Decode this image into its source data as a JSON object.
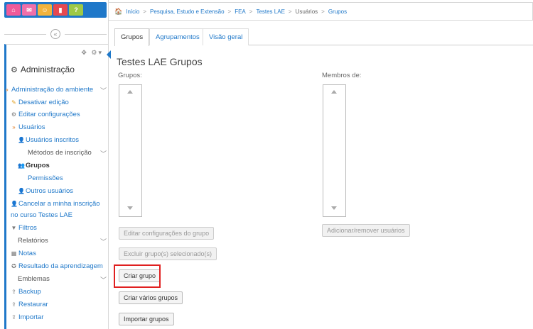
{
  "topbar": {
    "buttons": [
      {
        "icon": "home-icon",
        "glyph": "⌂"
      },
      {
        "icon": "mail-icon",
        "glyph": "✉"
      },
      {
        "icon": "users-icon",
        "glyph": "☺"
      },
      {
        "icon": "bookmark-icon",
        "glyph": "▮"
      },
      {
        "icon": "help-icon",
        "glyph": "?"
      }
    ],
    "colors": [
      "#f05a9a",
      "#ef6fa9",
      "#f2b33d",
      "#e7484f",
      "#9ec946"
    ],
    "accent": "#1f78c9"
  },
  "sidebar": {
    "collapse_glyph": "«",
    "block_controls": "✥ ⚙▾",
    "block_title": "Administração",
    "items": [
      {
        "label": "Administração do ambiente",
        "icon": "chevron-right-icon",
        "glyph": "»",
        "chevron": "﹀"
      },
      {
        "label": "Desativar edição",
        "icon": "pencil-icon",
        "glyph": "✎"
      },
      {
        "label": "Editar configurações",
        "icon": "gear-icon",
        "glyph": "⚙"
      },
      {
        "label": "Usuários",
        "icon": "chevron-right-icon",
        "glyph": "»"
      },
      {
        "label": "Usuários inscritos",
        "icon": "user-icon",
        "glyph": "👤"
      },
      {
        "label": "Métodos de inscrição",
        "chevron": "﹀"
      },
      {
        "label": "Grupos",
        "icon": "group-icon",
        "glyph": "👥"
      },
      {
        "label": "Permissões"
      },
      {
        "label": "Outros usuários",
        "icon": "user-icon",
        "glyph": "👤"
      },
      {
        "label": "Cancelar a minha inscrição",
        "icon": "user-icon",
        "glyph": "👤"
      },
      {
        "label": "no curso Testes LAE"
      },
      {
        "label": "Filtros",
        "icon": "filter-icon",
        "glyph": "▼"
      },
      {
        "label": "Relatórios",
        "chevron": "﹀"
      },
      {
        "label": "Notas",
        "icon": "table-icon",
        "glyph": "▦"
      },
      {
        "label": "Resultado da aprendizagem",
        "icon": "trophy-icon",
        "glyph": "✪"
      },
      {
        "label": "Emblemas",
        "chevron": "﹀"
      },
      {
        "label": "Backup",
        "icon": "upload-icon",
        "glyph": "⇪"
      },
      {
        "label": "Restaurar",
        "icon": "upload-icon",
        "glyph": "⇪"
      },
      {
        "label": "Importar",
        "icon": "upload-icon",
        "glyph": "⇪"
      }
    ]
  },
  "breadcrumb": {
    "home_glyph": "🏠",
    "items": [
      "Início",
      "Pesquisa, Estudo e Extensão",
      "FEA",
      "Testes LAE",
      "Usuários",
      "Grupos"
    ],
    "separator": ">"
  },
  "tabs": [
    "Grupos",
    "Agrupamentos",
    "Visão geral"
  ],
  "main": {
    "title": "Testes LAE Grupos",
    "groups_label": "Grupos:",
    "members_label": "Membros de:",
    "buttons": {
      "edit_group_settings": "Editar configurações do grupo",
      "delete_groups": "Excluir grupo(s) selecionado(s)",
      "create_group": "Criar grupo",
      "create_multiple": "Criar vários grupos",
      "import_groups": "Importar grupos",
      "add_remove_users": "Adicionar/remover usuários"
    },
    "highlight_color": "#e02020"
  }
}
